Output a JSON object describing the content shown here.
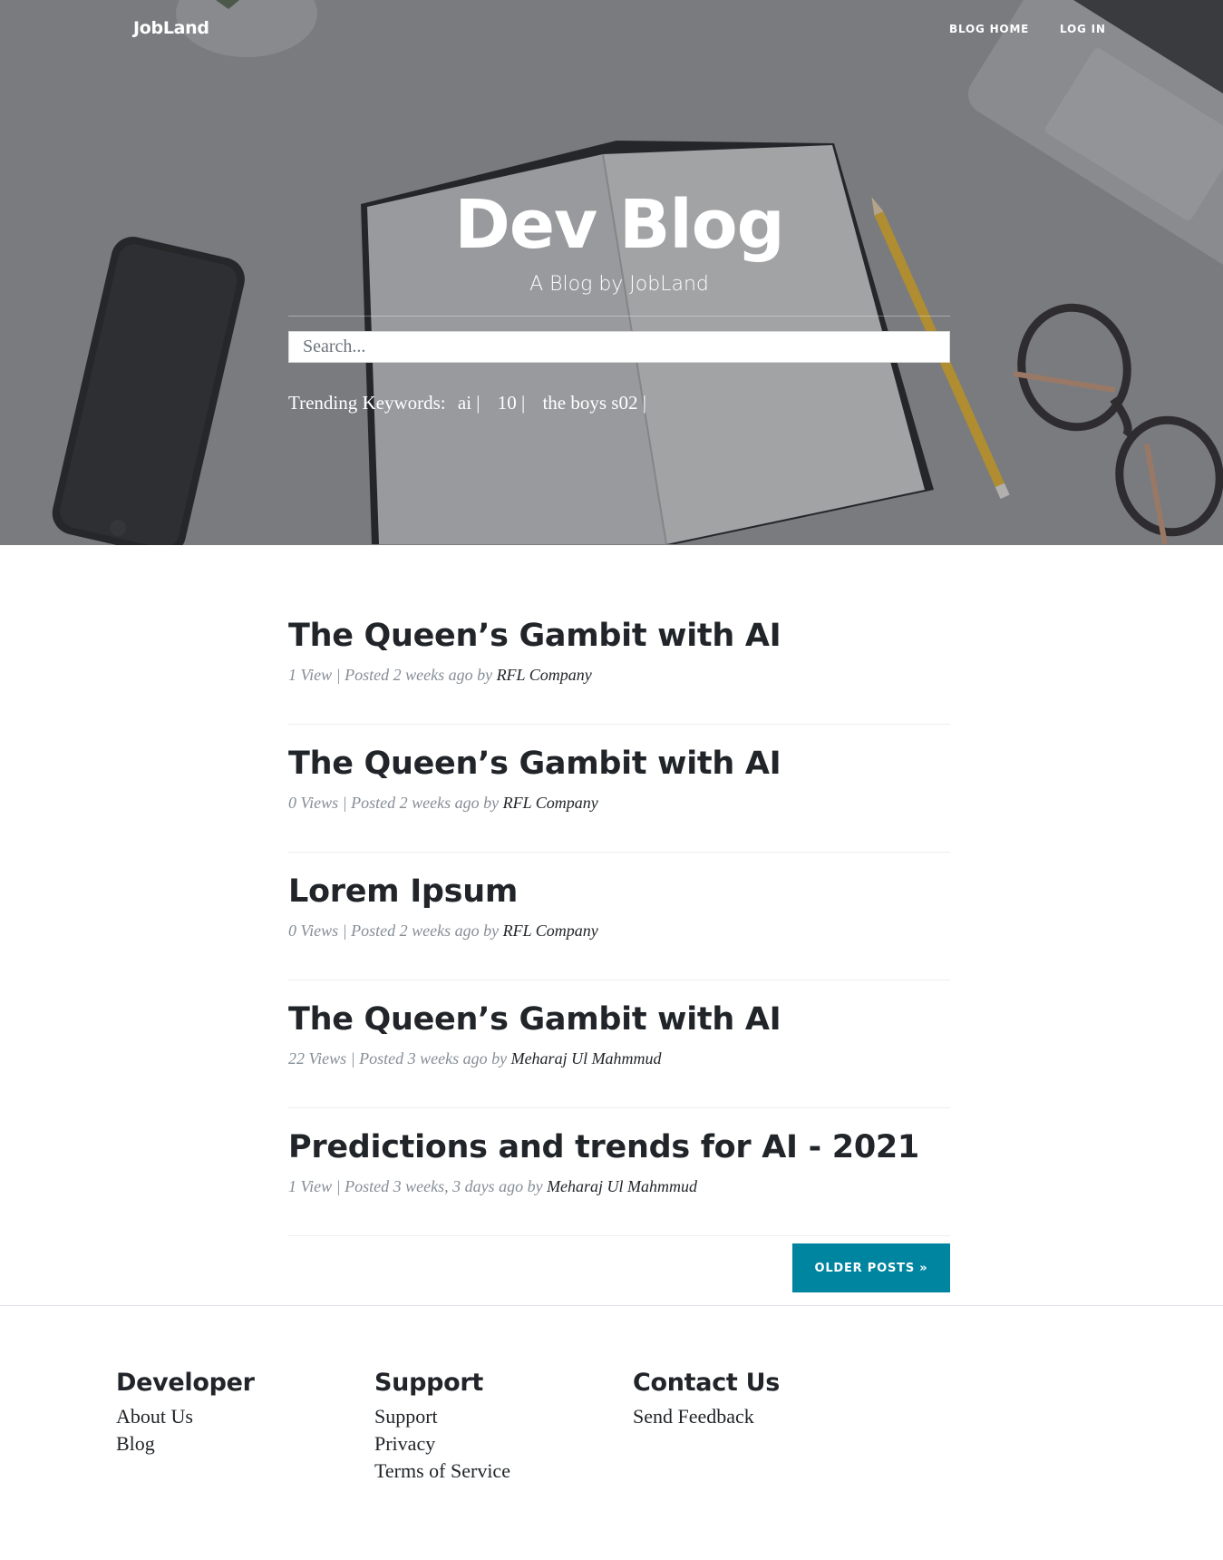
{
  "nav": {
    "brand": "JobLand",
    "links": [
      "BLOG HOME",
      "LOG IN"
    ]
  },
  "hero": {
    "title": "Dev Blog",
    "subtitle": "A Blog by JobLand",
    "search_placeholder": "Search...",
    "trending_label": "Trending Keywords:",
    "trending": [
      "ai |",
      "10 |",
      "the boys s02 |"
    ]
  },
  "posts": [
    {
      "title": "The Queen’s Gambit with AI",
      "meta": "1 View | Posted 2 weeks ago by",
      "author": "RFL Company"
    },
    {
      "title": "The Queen’s Gambit with AI",
      "meta": "0 Views | Posted 2 weeks ago by",
      "author": "RFL Company"
    },
    {
      "title": "Lorem Ipsum",
      "meta": "0 Views | Posted 2 weeks ago by",
      "author": "RFL Company"
    },
    {
      "title": "The Queen’s Gambit with AI",
      "meta": "22 Views | Posted 3 weeks ago by",
      "author": "Meharaj Ul Mahmmud"
    },
    {
      "title": "Predictions and trends for AI - 2021",
      "meta": "1 View | Posted 3 weeks, 3 days ago by",
      "author": "Meharaj Ul Mahmmud"
    }
  ],
  "pager": {
    "older_label": "OLDER POSTS »"
  },
  "footer": {
    "developer": {
      "heading": "Developer",
      "links": [
        "About Us",
        "Blog"
      ]
    },
    "support": {
      "heading": "Support",
      "links": [
        "Support",
        "Privacy",
        "Terms of Service"
      ]
    },
    "contact": {
      "heading": "Contact Us",
      "links": [
        "Send Feedback"
      ]
    }
  },
  "colors": {
    "accent": "#0085a1",
    "text": "#212529",
    "meta": "#868e96"
  }
}
